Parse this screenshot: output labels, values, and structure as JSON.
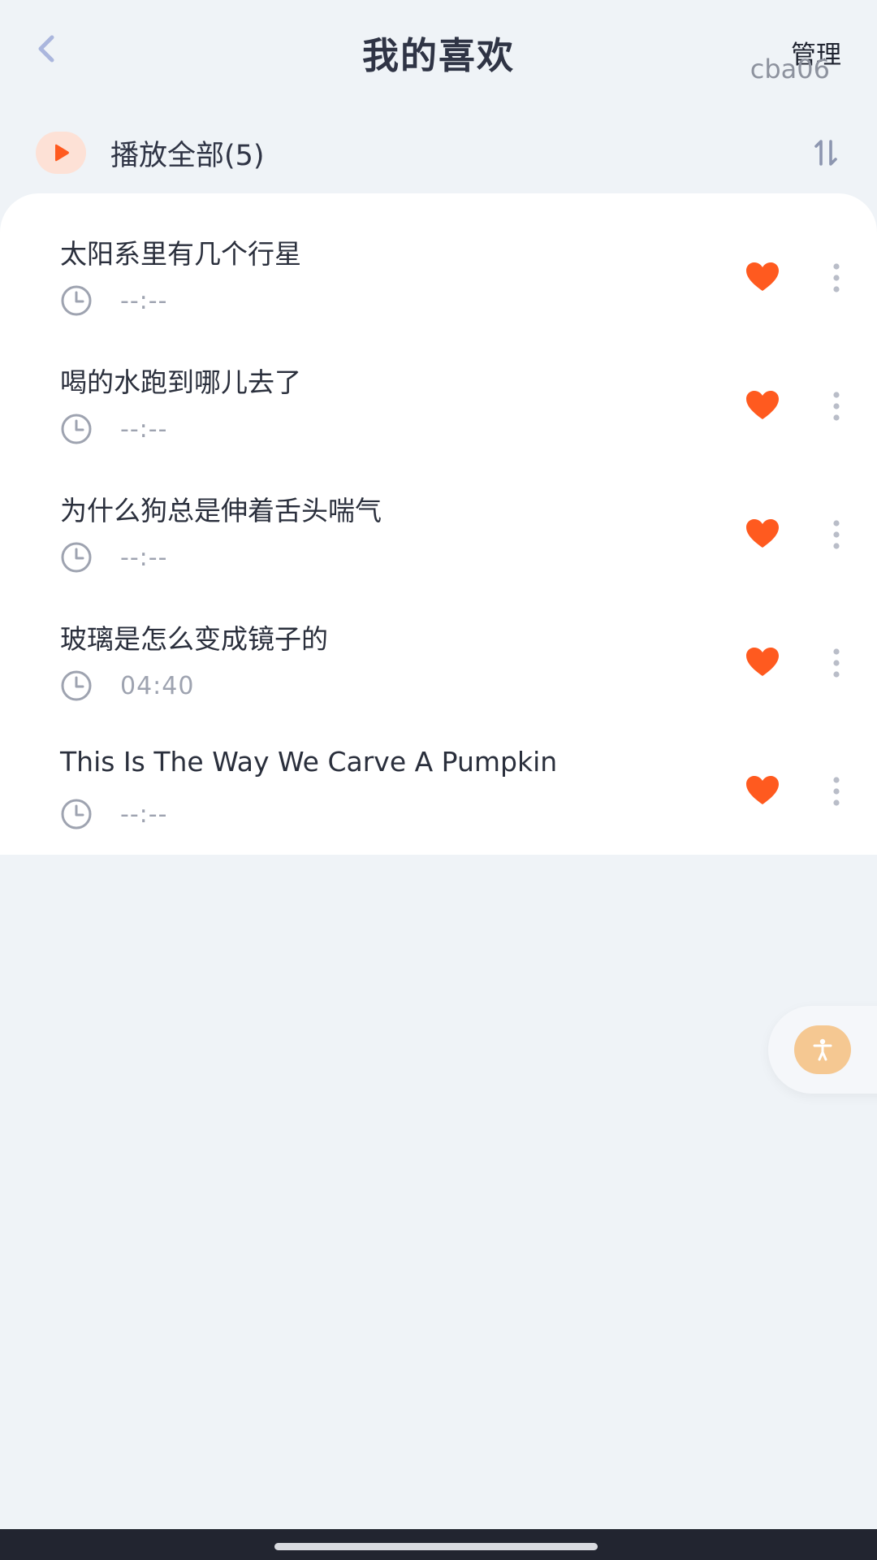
{
  "header": {
    "title": "我的喜欢",
    "manage_label": "管理",
    "watermark": "cba06"
  },
  "play_all": {
    "label": "播放全部(5)"
  },
  "colors": {
    "accent": "#ff5a1f",
    "heart": "#ff5a1f",
    "back_arrow": "#aab6dd",
    "icon_gray": "#9ea3b0",
    "float_button": "#f5c892"
  },
  "icons": {
    "back": "chevron-left-icon",
    "play": "play-icon",
    "sort": "sort-icon",
    "clock": "clock-icon",
    "favorite": "heart-icon",
    "more": "more-vertical-icon",
    "accessibility": "accessibility-icon"
  },
  "items": [
    {
      "title": "太阳系里有几个行星",
      "duration": "--:--",
      "favorited": true
    },
    {
      "title": "喝的水跑到哪儿去了",
      "duration": "--:--",
      "favorited": true
    },
    {
      "title": "为什么狗总是伸着舌头喘气",
      "duration": "--:--",
      "favorited": true
    },
    {
      "title": "玻璃是怎么变成镜子的",
      "duration": "04:40",
      "favorited": true
    },
    {
      "title": "This Is The Way We Carve A Pumpkin",
      "duration": "--:--",
      "favorited": true
    }
  ]
}
